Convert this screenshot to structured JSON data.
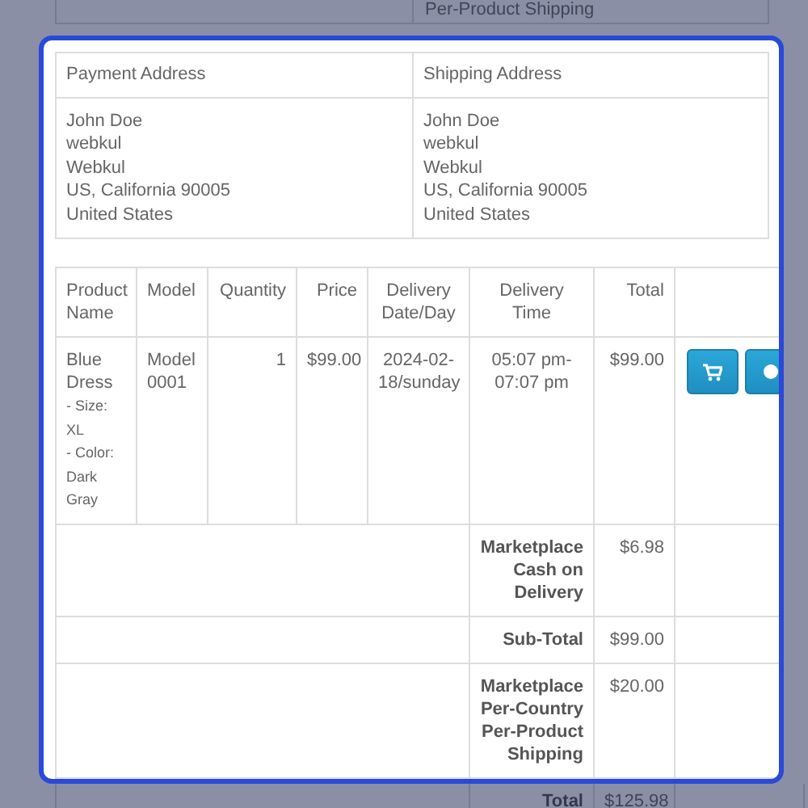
{
  "context_above": {
    "text": "Per-Product Shipping"
  },
  "addresses": {
    "columns": [
      "Payment Address",
      "Shipping Address"
    ],
    "blocks": [
      [
        "John Doe",
        "webkul",
        "Webkul",
        "US, California 90005",
        "United States"
      ],
      [
        "John Doe",
        "webkul",
        "Webkul",
        "US, California 90005",
        "United States"
      ]
    ]
  },
  "products": {
    "columns": [
      "Product Name",
      "Model",
      "Quantity",
      "Price",
      "Delivery Date/Day",
      "Delivery Time",
      "Total"
    ],
    "rows": [
      {
        "name": "Blue Dress",
        "options": [
          "- Size: XL",
          "- Color: Dark Gray"
        ],
        "model": "Model 0001",
        "quantity": "1",
        "price": "$99.00",
        "delivery_date": "2024-02-18/sunday",
        "delivery_time": "05:07 pm-07:07 pm",
        "total": "$99.00",
        "actions": [
          {
            "kind": "cart"
          },
          {
            "kind": "round"
          }
        ]
      }
    ]
  },
  "totals": [
    {
      "label": "Marketplace Cash on Delivery",
      "value": "$6.98",
      "highlighted": true
    },
    {
      "label": "Sub-Total",
      "value": "$99.00",
      "highlighted": true
    },
    {
      "label": "Marketplace Per-Country Per-Product Shipping",
      "value": "$20.00",
      "highlighted": true
    },
    {
      "label": "Total",
      "value": "$125.98",
      "highlighted": false
    }
  ]
}
